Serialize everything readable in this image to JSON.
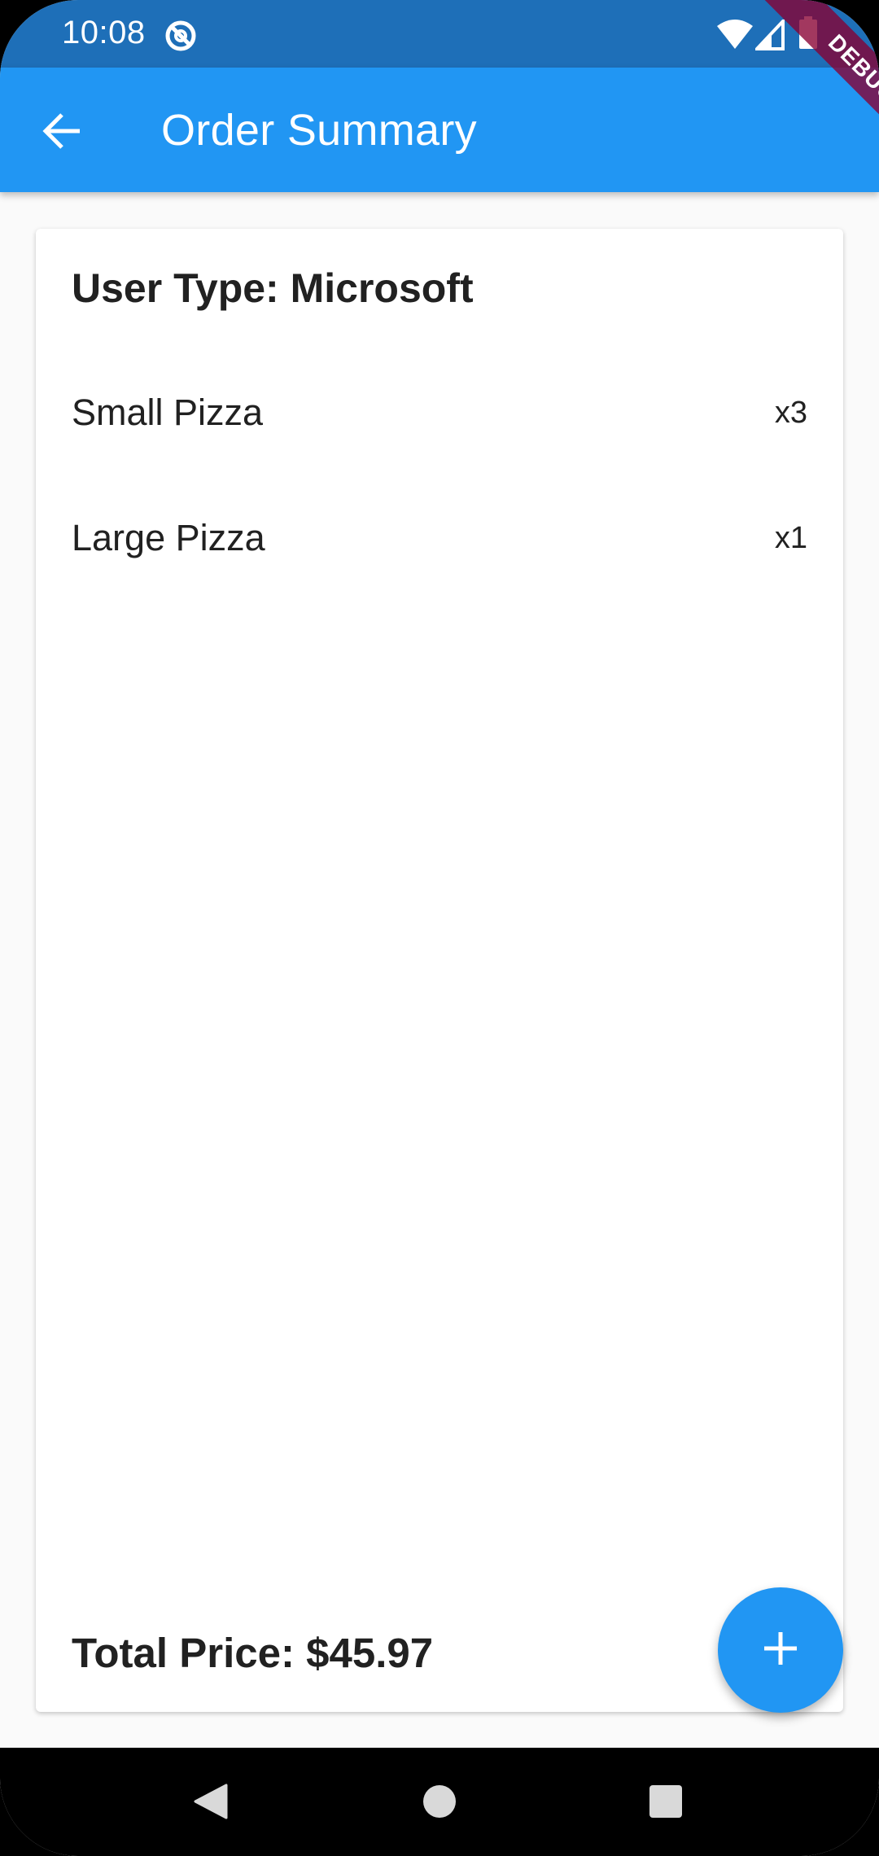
{
  "status_bar": {
    "time": "10:08",
    "icons": [
      "sync-icon",
      "wifi-icon",
      "signal-icon",
      "battery-icon"
    ]
  },
  "app_bar": {
    "title": "Order Summary",
    "back_icon": "arrow-back-icon",
    "color": "#2196f3"
  },
  "debug_banner": {
    "label": "DEBUG"
  },
  "order": {
    "user_type_label": "User Type: Microsoft",
    "items": [
      {
        "name": "Small Pizza",
        "quantity": "x3"
      },
      {
        "name": "Large Pizza",
        "quantity": "x1"
      }
    ],
    "total_label": "Total Price: $45.97"
  },
  "fab": {
    "icon": "add-icon",
    "color": "#2196f3"
  },
  "nav_bar": {
    "buttons": [
      "back-triangle-icon",
      "home-circle-icon",
      "recents-square-icon"
    ]
  }
}
